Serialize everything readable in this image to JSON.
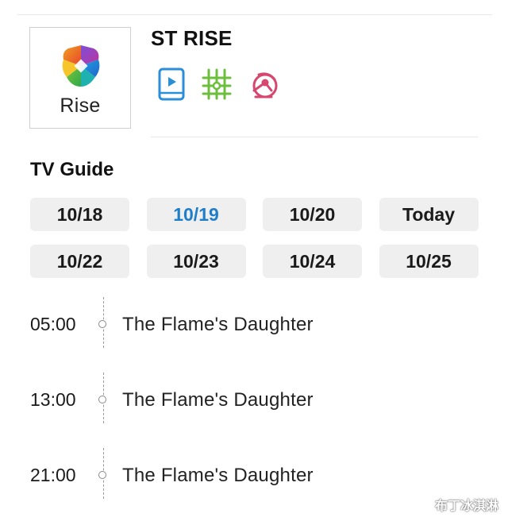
{
  "channel": {
    "logo_text": "Rise",
    "title": "ST RISE",
    "feature_icons": [
      "play-video-icon",
      "schedule-grid-icon",
      "cycling-icon"
    ]
  },
  "guide": {
    "title": "TV Guide",
    "dates": [
      {
        "label": "10/18",
        "active": false
      },
      {
        "label": "10/19",
        "active": true
      },
      {
        "label": "10/20",
        "active": false
      },
      {
        "label": "Today",
        "active": false
      },
      {
        "label": "10/22",
        "active": false
      },
      {
        "label": "10/23",
        "active": false
      },
      {
        "label": "10/24",
        "active": false
      },
      {
        "label": "10/25",
        "active": false
      }
    ]
  },
  "schedule": [
    {
      "time": "05:00",
      "title": "The Flame's Daughter"
    },
    {
      "time": "13:00",
      "title": "The Flame's Daughter"
    },
    {
      "time": "21:00",
      "title": "The Flame's Daughter"
    }
  ],
  "colors": {
    "accent": "#1f7ec9",
    "chip_bg": "#efefef",
    "play_icon": "#2a8fd6",
    "grid_icon": "#6bbf3a",
    "bike_icon": "#d6466e"
  },
  "watermark": "布丁冰淇淋"
}
